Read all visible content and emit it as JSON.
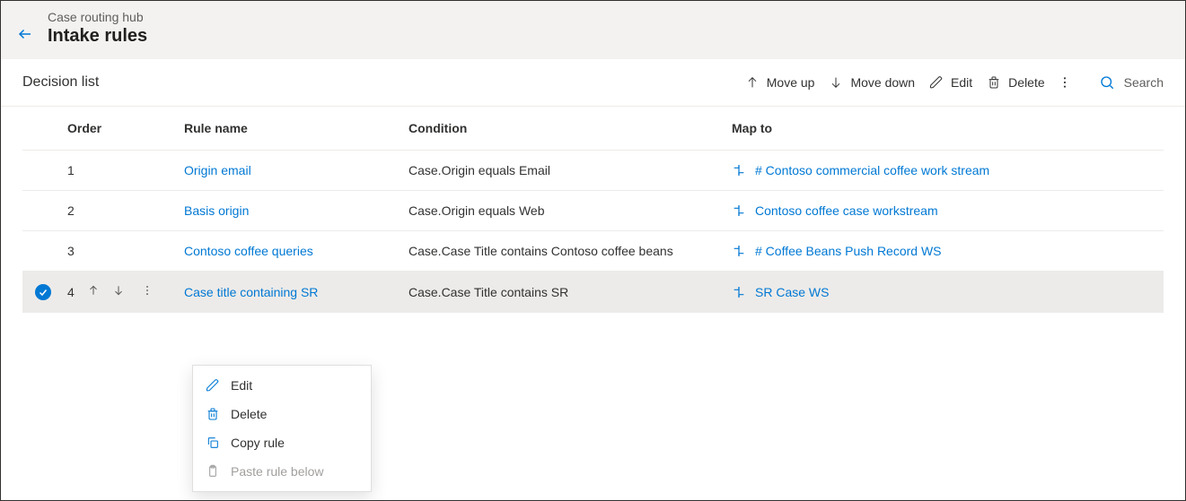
{
  "header": {
    "breadcrumb": "Case routing hub",
    "title": "Intake rules"
  },
  "section": {
    "title": "Decision list"
  },
  "commands": {
    "move_up": "Move up",
    "move_down": "Move down",
    "edit": "Edit",
    "delete": "Delete",
    "search": "Search"
  },
  "columns": {
    "order": "Order",
    "rule_name": "Rule name",
    "condition": "Condition",
    "map_to": "Map to"
  },
  "rows": [
    {
      "order": "1",
      "rule_name": "Origin email",
      "condition": "Case.Origin equals Email",
      "map_to": "# Contoso commercial coffee work stream"
    },
    {
      "order": "2",
      "rule_name": "Basis origin",
      "condition": "Case.Origin equals Web",
      "map_to": "Contoso coffee case workstream"
    },
    {
      "order": "3",
      "rule_name": "Contoso coffee queries",
      "condition": "Case.Case Title contains Contoso coffee beans",
      "map_to": "# Coffee Beans Push Record WS"
    },
    {
      "order": "4",
      "rule_name": "Case title containing SR",
      "condition": "Case.Case Title contains SR",
      "map_to": "SR Case WS"
    }
  ],
  "context_menu": {
    "edit": "Edit",
    "delete": "Delete",
    "copy": "Copy rule",
    "paste": "Paste rule below"
  }
}
